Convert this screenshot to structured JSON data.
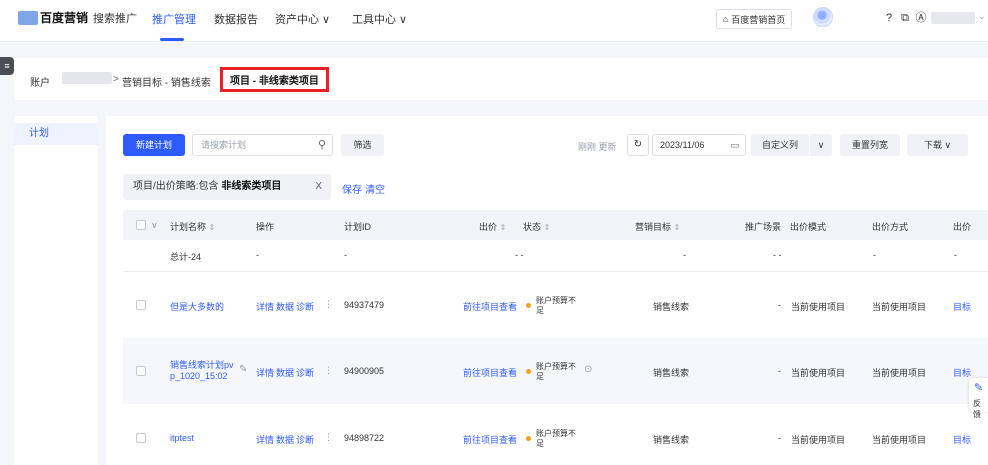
{
  "topnav": {
    "brand": "百度营销",
    "product": "搜索推广",
    "items": [
      {
        "label": "推广管理",
        "active": true
      },
      {
        "label": "数据报告",
        "active": false
      },
      {
        "label": "资产中心 ∨",
        "active": false
      },
      {
        "label": "工具中心 ∨",
        "active": false
      }
    ],
    "home_button": "百度营销首页",
    "accent_color": "#2e5bff"
  },
  "breadcrumb": {
    "account_label": "账户",
    "separator": ">",
    "goal": "营销目标 - 销售线索",
    "project": "项目 - 非线索类项目"
  },
  "sidebar": {
    "tab": "计划"
  },
  "toolbar": {
    "new_plan": "新建计划",
    "search_placeholder": "请搜索计划",
    "filter": "筛选",
    "updated": "刚刚 更新",
    "date": "2023/11/06",
    "custom_columns": "自定义列",
    "reset_columns": "重置列宽",
    "download": "下载 ∨"
  },
  "filter_chip": {
    "prefix": "项目/出价策略:包含 ",
    "value": "非线索类项目",
    "close": "X",
    "save": "保存",
    "clear": "清空"
  },
  "table": {
    "headers": {
      "name": "计划名称",
      "ops": "操作",
      "id": "计划ID",
      "bid": "出价",
      "status": "状态",
      "goal": "营销目标",
      "scene": "推广场景",
      "bid_mode": "出价模式",
      "bid_method": "出价方式",
      "bid_cut": "出价"
    },
    "total": {
      "name": "总计-24",
      "ops": "-",
      "id": "-",
      "bid": "- -",
      "goal": "-",
      "scene": "- -",
      "bid_method": "-",
      "bid_cut": "-"
    },
    "row_ops": {
      "detail": "详情",
      "data": "数据",
      "diagnose": "诊断"
    },
    "rows": [
      {
        "name": "但是大多数的",
        "id": "94937479",
        "bid": "前往项目查看",
        "status": "账户预算不足",
        "goal": "销售线索",
        "scene": "-",
        "bid_mode": "当前使用项目",
        "bid_method": "当前使用项目",
        "target": "目标"
      },
      {
        "name_line1": "销售线索计划pv",
        "name_line2": "p_1020_15:02",
        "id": "94900905",
        "bid": "前往项目查看",
        "status": "账户预算不足",
        "goal": "销售线索",
        "scene": "-",
        "bid_mode": "当前使用项目",
        "bid_method": "当前使用项目",
        "target": "目标"
      },
      {
        "name": "itptest",
        "id": "94898722",
        "bid": "前往项目查看",
        "status": "账户预算不足",
        "goal": "销售线索",
        "scene": "-",
        "bid_mode": "当前使用项目",
        "bid_method": "当前使用项目",
        "target": "目标"
      }
    ]
  },
  "feedback": {
    "label": "反馈"
  }
}
